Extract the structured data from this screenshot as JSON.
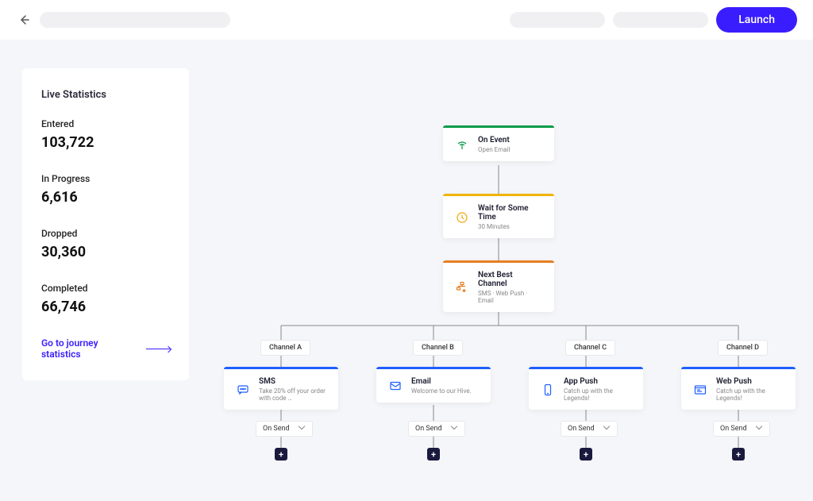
{
  "topbar": {
    "launch_label": "Launch"
  },
  "stats": {
    "title": "Live Statistics",
    "metrics": [
      {
        "label": "Entered",
        "value": "103,722"
      },
      {
        "label": "In Progress",
        "value": "6,616"
      },
      {
        "label": "Dropped",
        "value": "30,360"
      },
      {
        "label": "Completed",
        "value": "66,746"
      }
    ],
    "link_text": "Go to journey statistics"
  },
  "flow": {
    "root_nodes": [
      {
        "title": "On Event",
        "subtitle": "Open Email",
        "bar_color": "#0a9b4a",
        "icon": "event"
      },
      {
        "title": "Wait for Some Time",
        "subtitle": "30 Minutes",
        "bar_color": "#f0b400",
        "icon": "clock"
      },
      {
        "title": "Next Best Channel",
        "subtitle": "SMS · Web Push · Email",
        "bar_color": "#e67e22",
        "icon": "split"
      }
    ],
    "channels": [
      {
        "label": "Channel A",
        "title": "SMS",
        "subtitle": "Take 20% off your order with code …",
        "icon": "sms"
      },
      {
        "label": "Channel B",
        "title": "Email",
        "subtitle": "Welcome to our Hive.",
        "icon": "email"
      },
      {
        "label": "Channel C",
        "title": "App Push",
        "subtitle": "Catch up with the Legends!",
        "icon": "apppush"
      },
      {
        "label": "Channel D",
        "title": "Web Push",
        "subtitle": "Catch up with the Legends!",
        "icon": "webpush"
      }
    ],
    "on_send_label": "On Send"
  },
  "colors": {
    "accent": "#3a1dff"
  }
}
